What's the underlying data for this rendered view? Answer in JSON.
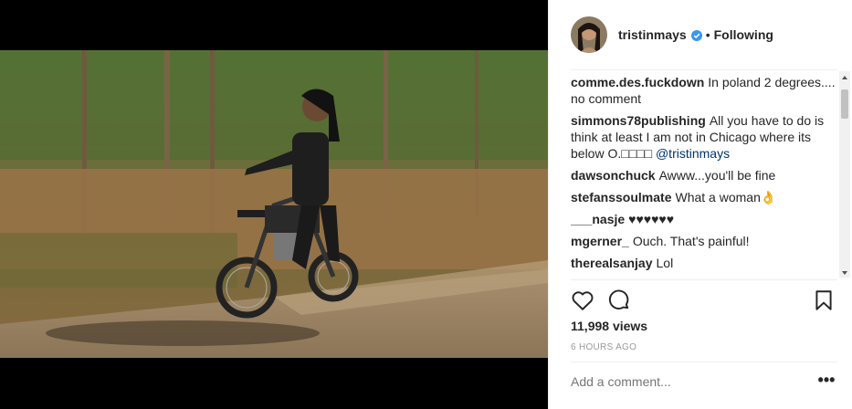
{
  "header": {
    "username": "tristinmays",
    "separator": "•",
    "follow_label": "Following"
  },
  "comments": [
    {
      "user": "comme.des.fuckdown",
      "text": "In poland 2 degrees.... no comment"
    },
    {
      "user": "simmons78publishing",
      "text": "All you have to do is think at least I am not in Chicago where its below O.□□□□",
      "mention": "@tristinmays"
    },
    {
      "user": "dawsonchuck",
      "text": "Awww...you'll be fine"
    },
    {
      "user": "stefanssoulmate",
      "text": "What a woman👌"
    },
    {
      "user": "___nasje",
      "text": "♥♥♥♥♥♥"
    },
    {
      "user": "mgerner_",
      "text": "Ouch. That's painful!"
    },
    {
      "user": "therealsanjay",
      "text": "Lol"
    }
  ],
  "stats": {
    "views": "11,998 views",
    "time": "6 HOURS AGO"
  },
  "add_comment": {
    "placeholder": "Add a comment..."
  },
  "more_label": "•••",
  "icons": {
    "like": "heart-icon",
    "comment": "comment-bubble-icon",
    "save": "bookmark-icon",
    "verified": "verified-badge-icon"
  },
  "colors": {
    "verified": "#3897f0",
    "text": "#262626",
    "muted": "#999999",
    "mention": "#003569"
  }
}
